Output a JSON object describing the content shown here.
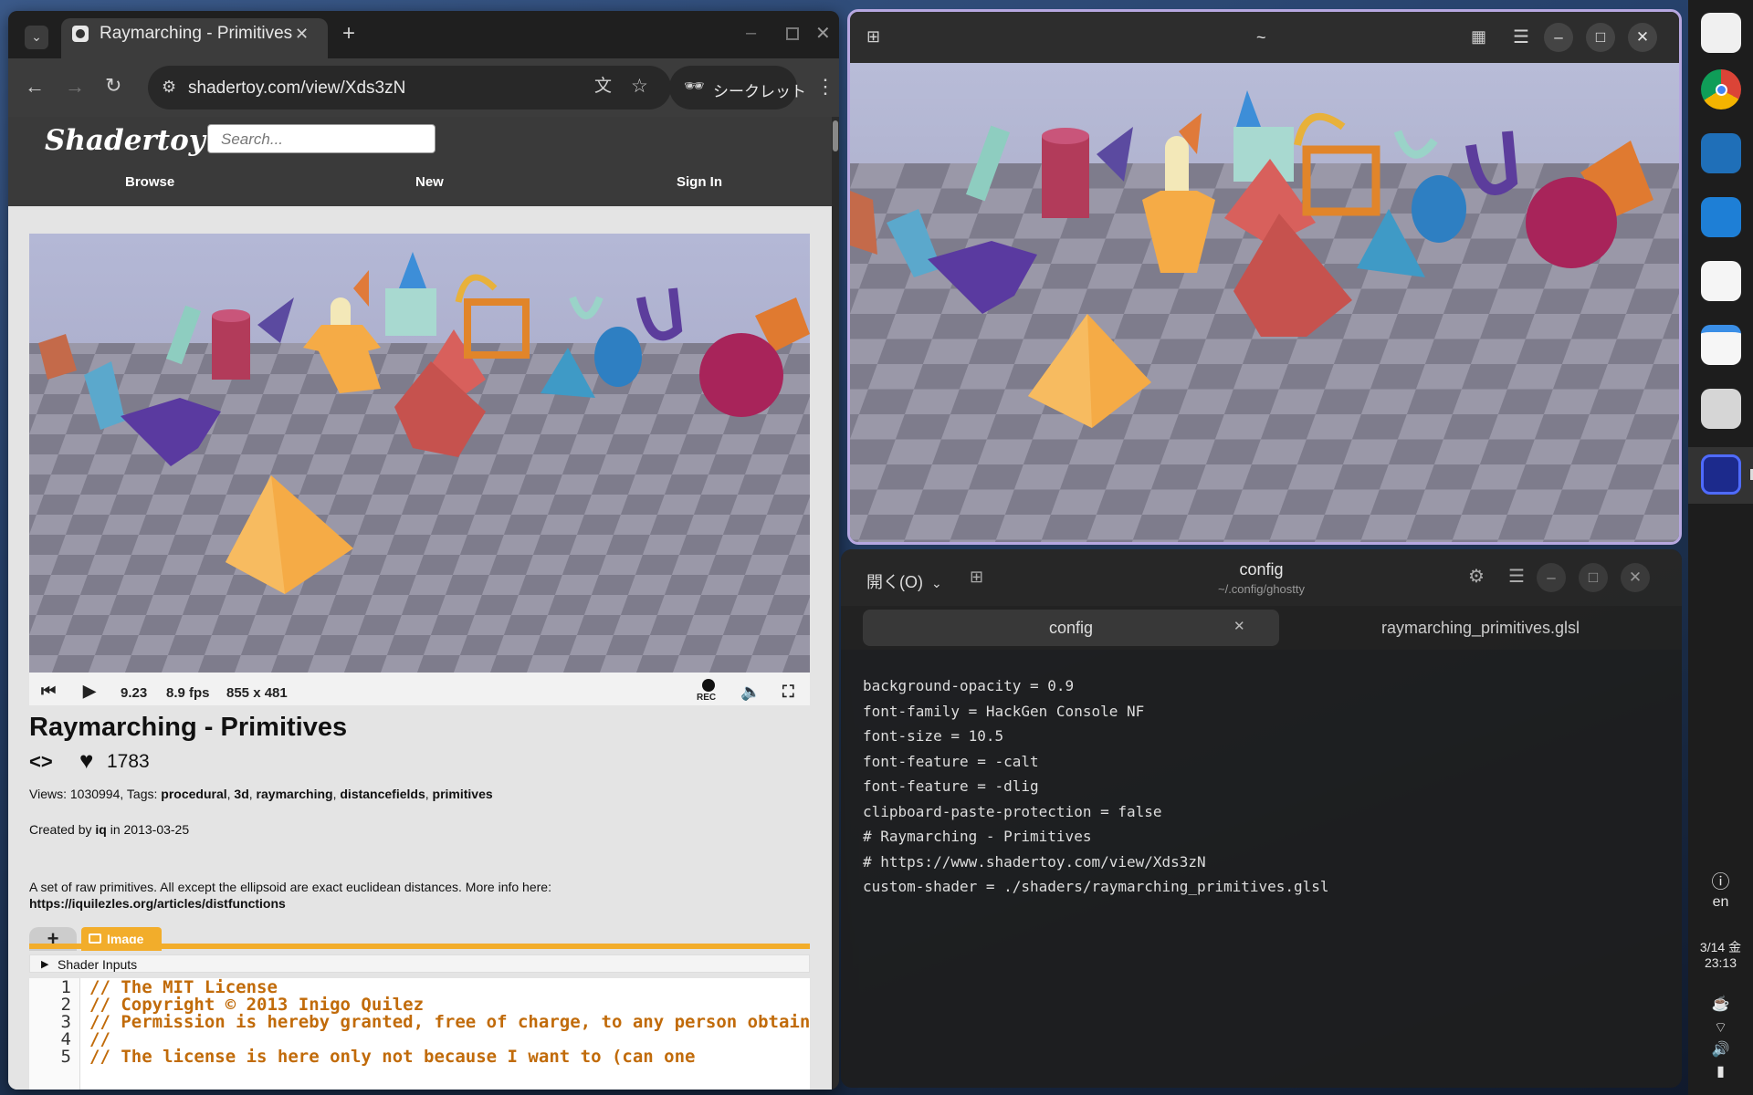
{
  "browser": {
    "tab_title": "Raymarching - Primitives",
    "url": "shadertoy.com/view/Xds3zN",
    "incognito_label": "シークレット"
  },
  "shadertoy": {
    "logo": "Shadertoy",
    "search_placeholder": "Search...",
    "nav": [
      "Browse",
      "New",
      "Sign In"
    ],
    "player": {
      "time": "9.23",
      "fps": "8.9 fps",
      "resolution": "855 x 481",
      "rec_label": "REC"
    },
    "title": "Raymarching - Primitives",
    "likes": "1783",
    "views_label": "Views:",
    "views": "1030994",
    "tags_label": "Tags:",
    "tags": [
      "procedural",
      "3d",
      "raymarching",
      "distancefields",
      "primitives"
    ],
    "created_prefix": "Created by",
    "author": "iq",
    "created_in": "in",
    "created_date": "2013-03-25",
    "description": "A set of raw primitives. All except the ellipsoid are exact euclidean distances. More info here:",
    "link": "https://iquilezles.org/articles/distfunctions",
    "tab_plus": "+",
    "tab_image": "Image",
    "shader_inputs": "Shader Inputs",
    "code_lines": [
      {
        "n": "1",
        "text": "// The MIT License"
      },
      {
        "n": "2",
        "text": "// Copyright © 2013 Inigo Quilez"
      },
      {
        "n": "3",
        "text": "// Permission is hereby granted, free of charge, to any person obtaining a cop"
      },
      {
        "n": "4",
        "text": "//"
      },
      {
        "n": "5",
        "text": "// The license is here only not because I want to (can one"
      }
    ]
  },
  "viewer": {
    "title": "~"
  },
  "editor": {
    "open_label": "開く(O)",
    "title": "config",
    "subtitle": "~/.config/ghostty",
    "tabs": [
      "config",
      "raymarching_primitives.glsl"
    ],
    "lines": [
      "background-opacity = 0.9",
      "",
      "font-family = HackGen Console NF",
      "font-size = 10.5",
      "font-feature = -calt",
      "font-feature = -dlig",
      "",
      "clipboard-paste-protection = false",
      "",
      "# Raymarching - Primitives",
      "# https://www.shadertoy.com/view/Xds3zN",
      "custom-shader = ./shaders/raymarching_primitives.glsl"
    ]
  },
  "dock": {
    "lang": "en",
    "date": "3/14 金",
    "time": "23:13"
  }
}
